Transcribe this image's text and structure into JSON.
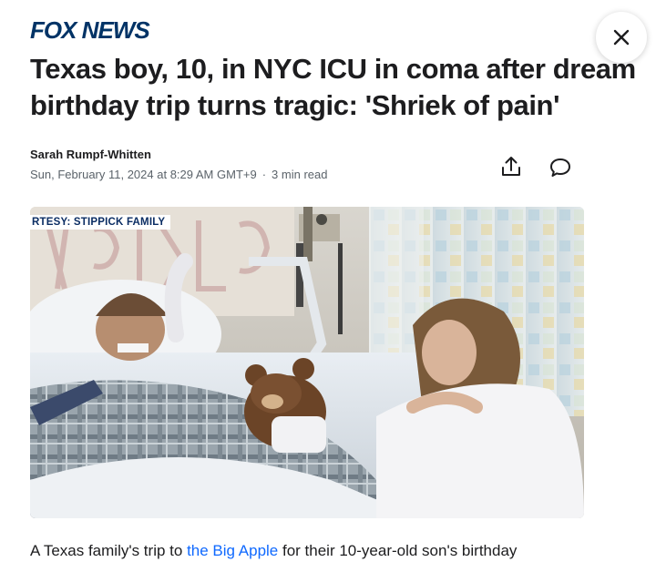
{
  "header": {
    "logo_text": "FOX NEWS",
    "close_icon": "close-icon"
  },
  "article": {
    "headline": "Texas boy, 10, in NYC ICU in coma after dream birthday trip turns tragic: 'Shriek of pain'",
    "author": "Sarah Rumpf-Whitten",
    "date": "Sun, February 11, 2024 at 8:29 AM GMT+9",
    "separator": "·",
    "read_time": "3 min read",
    "share_icon": "share-icon",
    "comment_icon": "comment-icon"
  },
  "photo": {
    "credit": "RTESY: STIPPICK FAMILY"
  },
  "body": {
    "text_before": "A Texas family's trip to ",
    "link_text": "the Big Apple",
    "text_after": " for their 10-year-old son's birthday"
  },
  "colors": {
    "brand": "#003366",
    "link": "#0f69ff",
    "text": "#1d1d1f",
    "muted": "#5b636a"
  }
}
